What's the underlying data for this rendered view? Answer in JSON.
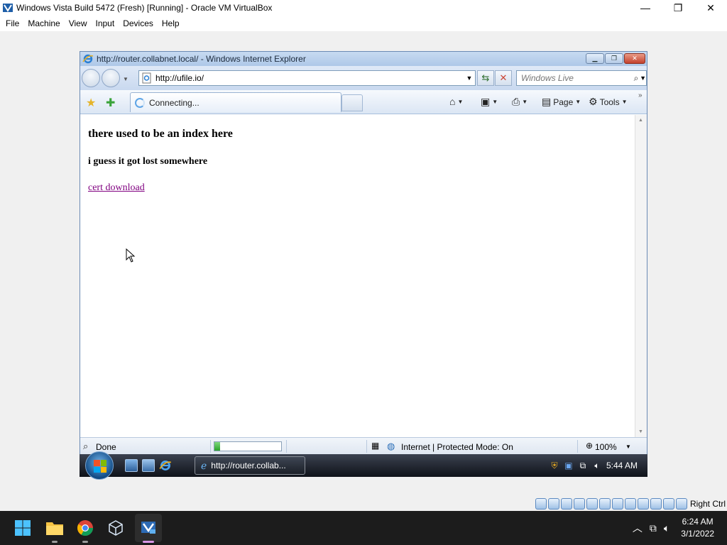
{
  "host_window": {
    "title": "Windows Vista Build 5472 (Fresh) [Running] - Oracle VM VirtualBox",
    "controls": {
      "minimize": "—",
      "restore": "❐",
      "close": "✕"
    },
    "menu": [
      "File",
      "Machine",
      "View",
      "Input",
      "Devices",
      "Help"
    ]
  },
  "ie": {
    "title": "http://router.collabnet.local/ - Windows Internet Explorer",
    "address": "http://ufile.io/",
    "search_placeholder": "Windows Live",
    "tab_label": "Connecting...",
    "commands": {
      "page": "Page",
      "tools": "Tools"
    },
    "content": {
      "heading": "there used to be an index here",
      "subheading": "i guess it got lost somewhere",
      "link": "cert download"
    },
    "status": {
      "text": "Done",
      "zone": "Internet | Protected Mode: On",
      "zoom": "100%",
      "progress": 0.08
    }
  },
  "vista_taskbar": {
    "task_label": "http://router.collab...",
    "clock": "5:44 AM"
  },
  "vbox_status": {
    "host_key": "Right Ctrl"
  },
  "win11_taskbar": {
    "time": "6:24 AM",
    "date": "3/1/2022"
  },
  "colors": {
    "ie_frame": "#aec8e8",
    "link_visited": "#800080",
    "vista_taskbar": "#1b1f27",
    "win11_taskbar": "#1c1c1c"
  },
  "icons": [
    "virtualbox-icon",
    "ie-icon",
    "back-icon",
    "forward-icon",
    "refresh-icon",
    "stop-icon",
    "search-icon",
    "favorites-star-icon",
    "add-favorites-icon",
    "home-icon",
    "feeds-icon",
    "print-icon",
    "page-icon",
    "tools-gear-icon",
    "globe-icon",
    "zoom-icon",
    "vista-start-orb-icon",
    "windows-start-icon",
    "file-explorer-icon",
    "chrome-icon",
    "virtualbox-manager-icon",
    "network-icon",
    "volume-icon"
  ]
}
